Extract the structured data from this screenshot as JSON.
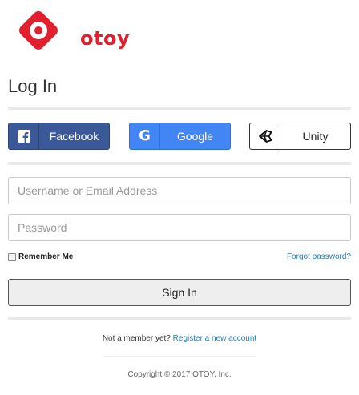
{
  "brand": {
    "name": "otoy",
    "color": "#e2202d"
  },
  "login": {
    "title": "Log In",
    "social": {
      "facebook": {
        "label": "Facebook",
        "icon": "facebook-icon",
        "color": "#3b5998"
      },
      "google": {
        "label": "Google",
        "icon": "google-icon",
        "color": "#4285f4"
      },
      "unity": {
        "label": "Unity",
        "icon": "unity-icon",
        "color": "#ffffff"
      }
    },
    "username": {
      "placeholder": "Username or Email Address",
      "value": ""
    },
    "password": {
      "placeholder": "Password",
      "value": ""
    },
    "remember_label": "Remember Me",
    "remember_checked": false,
    "forgot_label": "Forgot password?",
    "signin_label": "Sign In"
  },
  "footer": {
    "register_prompt": "Not a member yet?",
    "register_link": "Register a new account",
    "copyright": "Copyright © 2017 OTOY, Inc."
  }
}
